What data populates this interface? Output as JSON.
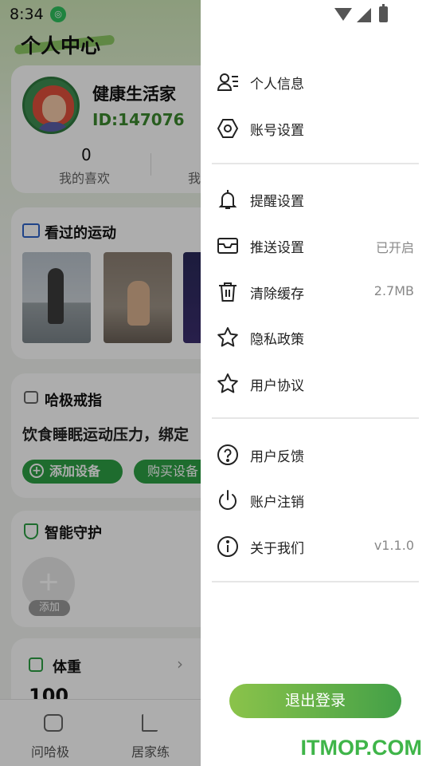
{
  "status_bar": {
    "time": "8:34"
  },
  "background": {
    "page_title": "个人中心",
    "profile": {
      "name": "健康生活家",
      "id": "ID:147076",
      "likes_count": "0",
      "likes_label": "我的喜欢",
      "second_label": "我"
    },
    "watched": {
      "title": "看过的运动"
    },
    "ring": {
      "title": "哈极戒指",
      "description": "饮食睡眠运动压力，绑定",
      "add_device": "添加设备",
      "buy_device": "购买设备"
    },
    "guard": {
      "title": "智能守护",
      "add_label": "添加"
    },
    "weight": {
      "title": "体重",
      "value": "100",
      "chevron": "›"
    },
    "tabs": [
      {
        "label": "问哈极"
      },
      {
        "label": "居家练"
      }
    ]
  },
  "drawer": {
    "groups": [
      [
        {
          "icon": "person-list-icon",
          "label": "个人信息",
          "value": ""
        },
        {
          "icon": "hexagon-gear-icon",
          "label": "账号设置",
          "value": ""
        }
      ],
      [
        {
          "icon": "bell-icon",
          "label": "提醒设置",
          "value": ""
        },
        {
          "icon": "inbox-icon",
          "label": "推送设置",
          "value": "已开启"
        },
        {
          "icon": "trash-icon",
          "label": "清除缓存",
          "value": "2.7MB"
        },
        {
          "icon": "star-icon",
          "label": "隐私政策",
          "value": ""
        },
        {
          "icon": "star-icon",
          "label": "用户协议",
          "value": ""
        }
      ],
      [
        {
          "icon": "help-circle-icon",
          "label": "用户反馈",
          "value": ""
        },
        {
          "icon": "power-icon",
          "label": "账户注销",
          "value": ""
        },
        {
          "icon": "info-circle-icon",
          "label": "关于我们",
          "value": "v1.1.0"
        }
      ]
    ],
    "logout_label": "退出登录"
  },
  "watermark": "ITMOP.COM",
  "colors": {
    "accent": "#43a047",
    "accent_light": "#8bc34a",
    "overlay": "rgba(0,0,0,0.32)"
  }
}
